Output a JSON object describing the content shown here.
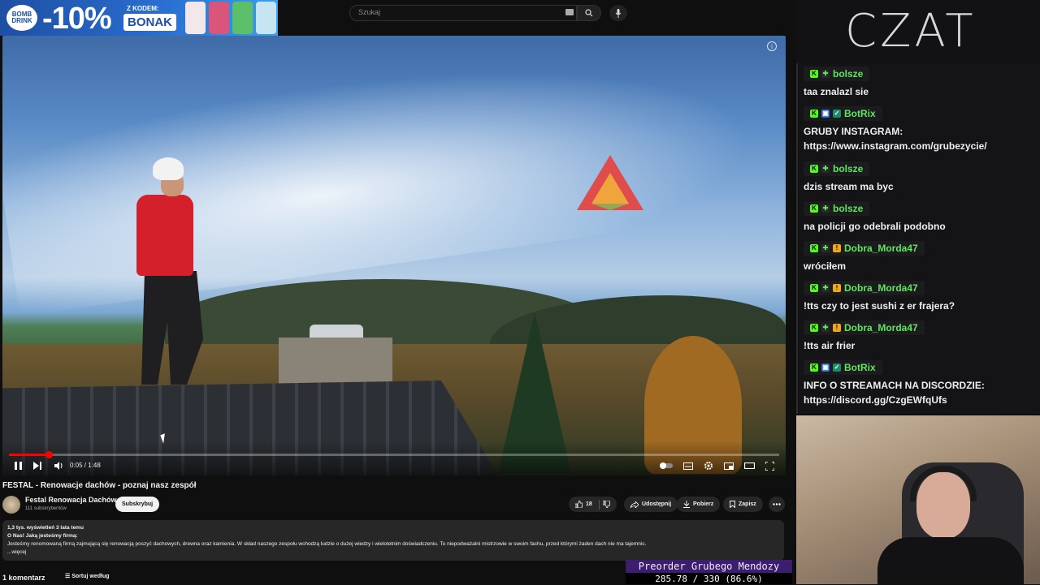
{
  "promo": {
    "brand": "BOMB DRINK",
    "discount": "-10%",
    "code_label": "Z KODEM:",
    "code": "BONAK",
    "can_colors": [
      "#f2e7ea",
      "#d9557a",
      "#5cc06b",
      "#c7e4f2"
    ]
  },
  "browser": {
    "search_placeholder": "Szukaj"
  },
  "video": {
    "progress_fraction": 0.052,
    "time_current": "0:05",
    "time_total": "1:48",
    "title": "FESTAL - Renowacje dachów - poznaj nasz zespół",
    "channel": "Festal Renowacja Dachów",
    "subscribers": "111 subskrybentów",
    "subscribe_label": "Subskrybuj",
    "likes": "18",
    "share_label": "Udostępnij",
    "download_label": "Pobierz",
    "save_label": "Zapisz",
    "description": {
      "stats": "1,3 tys. wyświetleń  3 lata temu",
      "line1": "O Nas! Jaką jesteśmy firmą:",
      "line2": "Jesteśmy renomowaną firmą zajmującą się renowacją poszyć dachowych, drewna oraz kamienia. W skład naszego zespołu wchodzą ludzie o dużej wiedzy i wieloletnim doświadczeniu. To niepodważalni mistrzowie w swoim fachu, przed którymi żaden dach nie ma tajemnic.",
      "more": "...więcej"
    },
    "comments_count": "1 komentarz",
    "sort_label": "Sortuj według"
  },
  "overlay": {
    "line1": "Preorder Grubego Mendozy",
    "line2": "285.78 / 330 (86.6%)"
  },
  "stream": {
    "chat_header": "CZAT",
    "colors": {
      "green": "#5ee65e",
      "kick": "#53fc18"
    },
    "messages": [
      {
        "user": "bolsze",
        "text": "taa znalazl sie",
        "badges": [
          "kick",
          "sub"
        ]
      },
      {
        "user": "BotRix",
        "text": "GRUBY INSTAGRAM: https://www.instagram.com/grubezycie/",
        "badges": [
          "kick",
          "bot",
          "verified"
        ]
      },
      {
        "user": "bolsze",
        "text": "dzis stream ma byc",
        "badges": [
          "kick",
          "sub"
        ]
      },
      {
        "user": "bolsze",
        "text": "na policji go odebrali podobno",
        "badges": [
          "kick",
          "sub"
        ]
      },
      {
        "user": "Dobra_Morda47",
        "text": "wróciłem",
        "badges": [
          "kick",
          "sub",
          "gift"
        ]
      },
      {
        "user": "Dobra_Morda47",
        "text": "!tts czy to jest sushi z er frajera?",
        "badges": [
          "kick",
          "sub",
          "gift"
        ]
      },
      {
        "user": "Dobra_Morda47",
        "text": "!tts air frier",
        "badges": [
          "kick",
          "sub",
          "gift"
        ]
      },
      {
        "user": "BotRix",
        "text": "INFO O STREAMACH NA DISCORDZIE: https://discord.gg/CzgEWfqUfs",
        "badges": [
          "kick",
          "bot",
          "verified"
        ]
      }
    ]
  }
}
